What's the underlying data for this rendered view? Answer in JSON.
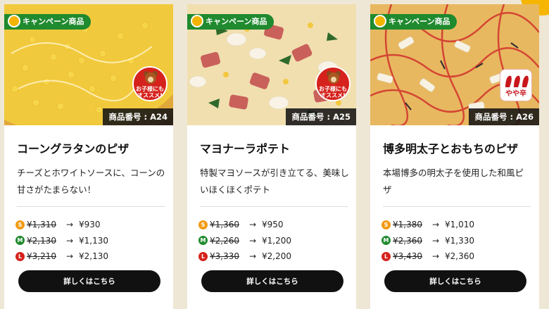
{
  "campaign_label": "キャンペーン商品",
  "detail_label": "詳しくはこちら",
  "arrow": "→",
  "colors": {
    "campaign_green": "#1f8a2e",
    "size_s": "#f29a14",
    "size_m": "#1f8a2e",
    "size_l": "#d6221c",
    "button_black": "#111111"
  },
  "cards": [
    {
      "product_no": "商品番号 : A24",
      "title": "コーングラタンのピザ",
      "desc": "チーズとホワイトソースに、コーンの甘さがたまらない！",
      "badge": "お子様にもオススメ!",
      "prices": [
        {
          "size": "S",
          "old": "¥1,310",
          "new": "¥930"
        },
        {
          "size": "M",
          "old": "¥2,130",
          "new": "¥1,130"
        },
        {
          "size": "L",
          "old": "¥3,210",
          "new": "¥2,130"
        }
      ]
    },
    {
      "product_no": "商品番号 : A25",
      "title": "マヨナーラポテト",
      "desc": "特製マヨソースが引き立てる、美味しいほくほくポテト",
      "badge": "お子様にもオススメ!",
      "prices": [
        {
          "size": "S",
          "old": "¥1,360",
          "new": "¥950"
        },
        {
          "size": "M",
          "old": "¥2,260",
          "new": "¥1,200"
        },
        {
          "size": "L",
          "old": "¥3,330",
          "new": "¥2,200"
        }
      ]
    },
    {
      "product_no": "商品番号 : A26",
      "title": "博多明太子とおもちのピザ",
      "desc": "本場博多の明太子を使用した和風ピザ",
      "badge": "やや辛",
      "prices": [
        {
          "size": "S",
          "old": "¥1,380",
          "new": "¥1,010"
        },
        {
          "size": "M",
          "old": "¥2,360",
          "new": "¥1,330"
        },
        {
          "size": "L",
          "old": "¥3,430",
          "new": "¥2,360"
        }
      ]
    }
  ]
}
